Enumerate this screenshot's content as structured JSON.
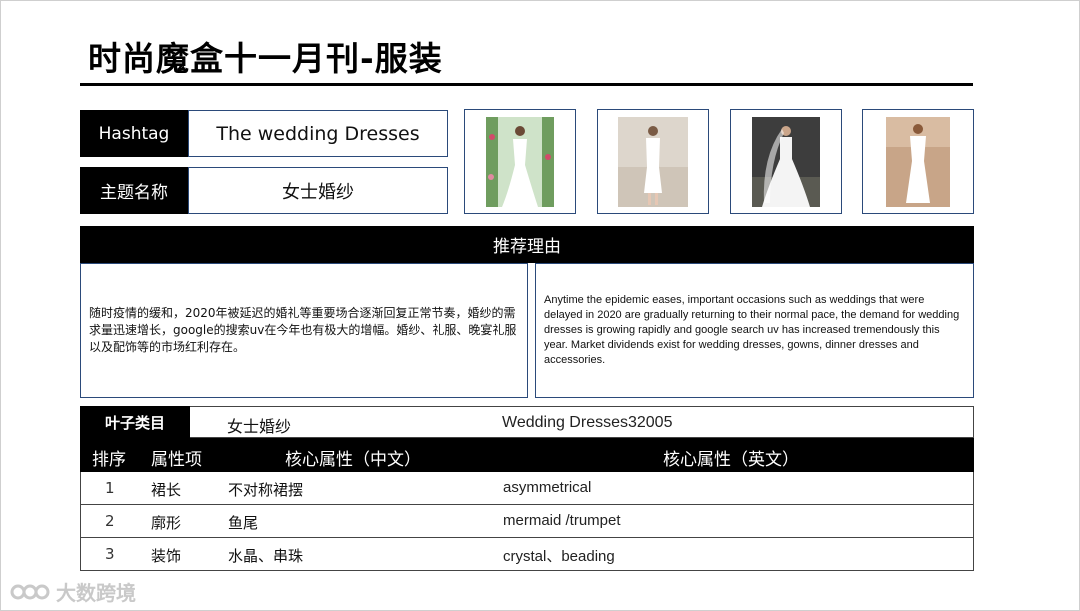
{
  "title": "时尚魔盒十一月刊-服装",
  "hashtag": {
    "label": "Hashtag",
    "value": "The wedding Dresses"
  },
  "theme": {
    "label": "主题名称",
    "value": "女士婚纱"
  },
  "images": [
    {
      "icon": "wedding-dress-photo",
      "bg": "#cfe3c9"
    },
    {
      "icon": "wedding-dress-photo",
      "bg": "#d8d1c9"
    },
    {
      "icon": "wedding-dress-photo",
      "bg": "#3b3b3b"
    },
    {
      "icon": "wedding-dress-photo",
      "bg": "#c9a98a"
    }
  ],
  "reason": {
    "heading": "推荐理由",
    "cn": "随时疫情的缓和，2020年被延迟的婚礼等重要场合逐渐回复正常节奏，婚纱的需求量迅速增长，google的搜索uv在今年也有极大的增幅。婚纱、礼服、晚宴礼服以及配饰等的市场红利存在。",
    "en": "Anytime the epidemic eases, important occasions such as weddings that were delayed in 2020 are gradually returning to their normal pace, the demand for wedding dresses is growing rapidly and google search uv has increased tremendously this year. Market dividends exist for wedding dresses, gowns, dinner dresses and accessories."
  },
  "leaf": {
    "label": "叶子类目",
    "cn": "女士婚纱",
    "en": "Wedding Dresses32005"
  },
  "table": {
    "headers": {
      "rank": "排序",
      "attr": "属性项",
      "cn": "核心属性（中文）",
      "en": "核心属性（英文）"
    },
    "rows": [
      {
        "rank": "1",
        "attr": "裙长",
        "cn": "不对称裙摆",
        "en": "asymmetrical"
      },
      {
        "rank": "2",
        "attr": "廓形",
        "cn": "鱼尾",
        "en": "mermaid /trumpet"
      },
      {
        "rank": "3",
        "attr": "装饰",
        "cn": "水晶、串珠",
        "en": "crystal、beading"
      }
    ]
  },
  "watermark": "大数跨境"
}
